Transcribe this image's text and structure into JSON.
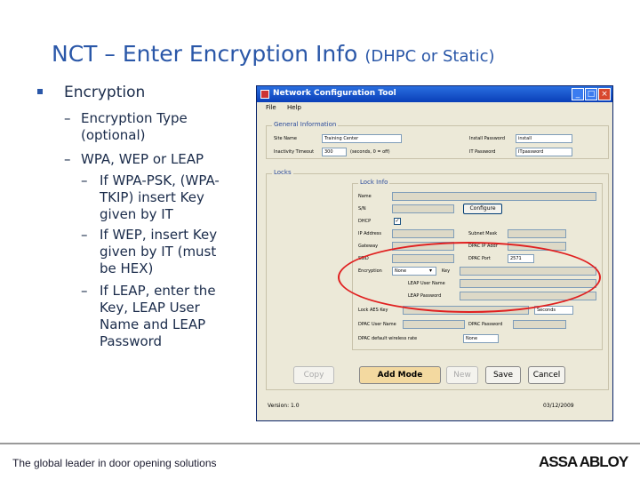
{
  "slide": {
    "title_main": "NCT – Enter Encryption Info",
    "title_sub": "(DHPC or Static)",
    "bullet": "Encryption",
    "sub1_line1": "Encryption Type",
    "sub1_line2": "(optional)",
    "sub2": "WPA, WEP or LEAP",
    "sub3_lines": [
      "If WPA-PSK, (WPA-",
      "TKIP) insert Key",
      "given by IT"
    ],
    "sub4_lines": [
      "If WEP, insert Key",
      "given by IT (must",
      "be HEX)"
    ],
    "sub5_lines": [
      "If LEAP, enter the",
      "Key, LEAP User",
      "Name and LEAP",
      "Password"
    ]
  },
  "window": {
    "title": "Network Configuration Tool",
    "menu": [
      "File",
      "Help"
    ],
    "general": {
      "label": "General Information",
      "site_name_label": "Site Name",
      "site_name_value": "Training Center",
      "inactivity_label": "Inactivity Timeout",
      "inactivity_value": "300",
      "inactivity_hint": "(seconds, 0 = off)",
      "install_pw_label": "Install Password",
      "install_pw_value": "install",
      "it_pw_label": "IT Password",
      "it_pw_value": "ITpassword"
    },
    "locks_label": "Locks",
    "lockinfo": {
      "label": "Lock Info",
      "name_label": "Name",
      "sn_label": "S/N",
      "configure_btn": "Configure",
      "dhcp_label": "DHCP",
      "dhcp_checked": "✓",
      "ip_label": "IP Address",
      "subnet_label": "Subnet Mask",
      "gateway_label": "Gateway",
      "dpac_ip_label": "DPAC IP Addr",
      "ssid_label": "SSID",
      "dpac_port_label": "DPAC Port",
      "dpac_port_value": "2571",
      "encryption_label": "Encryption",
      "encryption_value": "None",
      "key_label": "Key",
      "leap_user_label": "LEAP User Name",
      "leap_pw_label": "LEAP Password",
      "lock_aes_label": "Lock AES Key",
      "seconds_value": "Seconds",
      "dpac_user_label": "DPAC User Name",
      "dpac_pw_label": "DPAC Password",
      "dpac_default_label": "DPAC default wireless rate",
      "rate_value": "None"
    },
    "buttons": {
      "copy": "Copy",
      "add_mode": "Add Mode",
      "new": "New",
      "save": "Save",
      "cancel": "Cancel"
    },
    "version_label": "Version: 1.0",
    "date": "03/12/2009"
  },
  "footer": {
    "tagline": "The global leader in door opening solutions",
    "logo": "ASSA ABLOY"
  }
}
